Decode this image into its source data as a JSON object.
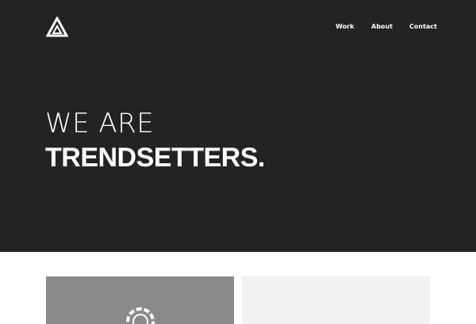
{
  "nav": {
    "items": [
      {
        "label": "Work"
      },
      {
        "label": "About"
      },
      {
        "label": "Contact"
      }
    ]
  },
  "hero": {
    "line1": "WE ARE",
    "line2": "TRENDSETTERS."
  },
  "colors": {
    "hero_bg": "#232323",
    "page_bg": "#ffffff",
    "card_left_bg": "#8a8a8a",
    "card_right_bg": "#f1f1f1",
    "text": "#ffffff"
  },
  "icons": {
    "logo": "triangle-logo-icon",
    "card": "circular-loader-icon"
  }
}
